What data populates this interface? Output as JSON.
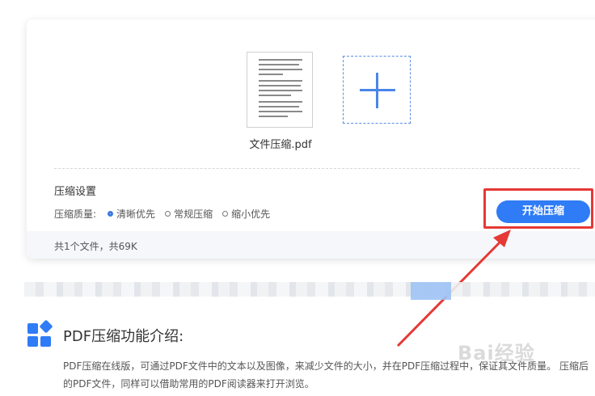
{
  "upload": {
    "file_name": "文件压缩.pdf"
  },
  "settings": {
    "title": "压缩设置",
    "quality_label": "压缩质量:",
    "options": [
      {
        "label": "清晰优先",
        "selected": true
      },
      {
        "label": "常规压缩",
        "selected": false
      },
      {
        "label": "缩小优先",
        "selected": false
      }
    ],
    "start_button": "开始压缩"
  },
  "summary": "共1个文件，共69K",
  "intro": {
    "title": "PDF压缩功能介绍:",
    "text": "PDF压缩在线版，可通过PDF文件中的文本以及图像，来减少文件的大小，并在PDF压缩过程中，保证其文件质量。 压缩后的PDF文件，同样可以借助常用的PDF阅读器来打开浏览。"
  },
  "watermark": "Bai经验",
  "colors": {
    "accent": "#2f7cf6",
    "annotation": "#e53935"
  }
}
